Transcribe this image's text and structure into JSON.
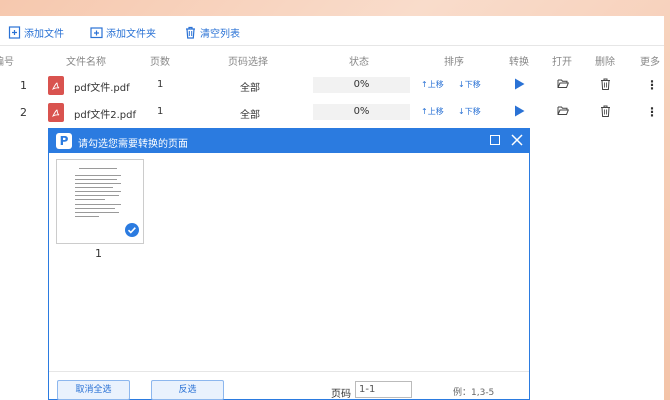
{
  "toolbar": {
    "add_file": "添加文件",
    "add_folder": "添加文件夹",
    "clear_list": "清空列表"
  },
  "columns": {
    "index": "编号",
    "filename": "文件名称",
    "pages": "页数",
    "page_select": "页码选择",
    "status": "状态",
    "order": "排序",
    "convert": "转换",
    "open": "打开",
    "delete": "删除",
    "more": "更多"
  },
  "rows": [
    {
      "index": "1",
      "filename": "pdf文件.pdf",
      "pages": "1",
      "page_select": "全部",
      "status": "0%",
      "up": "上移",
      "down": "下移"
    },
    {
      "index": "2",
      "filename": "pdf文件2.pdf",
      "pages": "1",
      "page_select": "全部",
      "status": "0%",
      "up": "上移",
      "down": "下移"
    }
  ],
  "dialog": {
    "logo": "P",
    "title": "请勾选您需要转换的页面",
    "thumbnails": [
      {
        "label": "1",
        "checked": true
      }
    ],
    "select_all_cancel": "取消全选",
    "invert_select": "反选",
    "page_label": "页码",
    "page_value": "1-1",
    "example": "例：1,3-5"
  },
  "colors": {
    "accent": "#2b7be0",
    "pdf_icon": "#d9534f"
  }
}
